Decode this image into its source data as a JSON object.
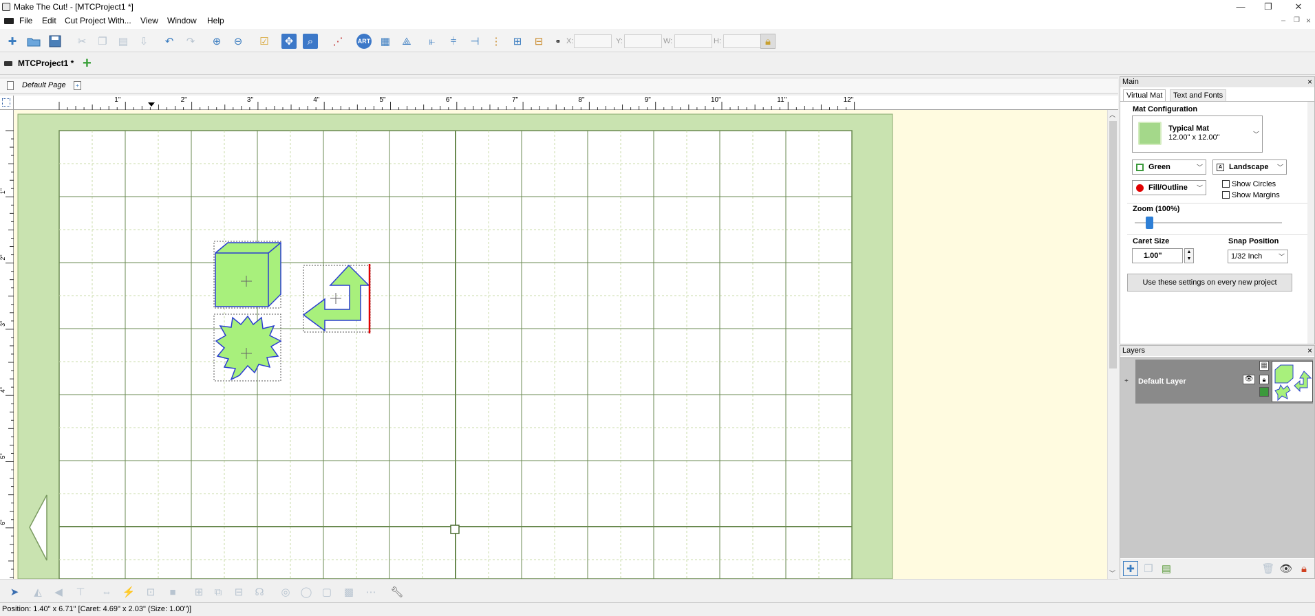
{
  "window": {
    "title": "Make The Cut! - [MTCProject1 *]",
    "minimize_glyph": "—",
    "maximize_glyph": "❐",
    "close_glyph": "✕"
  },
  "menu": {
    "items": [
      "File",
      "Edit",
      "Cut Project With...",
      "View",
      "Window",
      "Help"
    ]
  },
  "mdi": {
    "minimize_glyph": "–",
    "restore_glyph": "❐",
    "close_glyph": "×"
  },
  "toolbar": {
    "x_label": "X:",
    "y_label": "Y:",
    "w_label": "W:",
    "h_label": "H:",
    "x_value": "",
    "y_value": "",
    "w_value": "",
    "h_value": ""
  },
  "project_tab": {
    "label": "MTCProject1 *",
    "add_glyph": "+"
  },
  "page_tab": {
    "label": "Default Page"
  },
  "ruler": {
    "top_labels": [
      "1\"",
      "2\"",
      "3\"",
      "4\"",
      "5\"",
      "6\"",
      "7\"",
      "8\"",
      "9\"",
      "10\"",
      "11\"",
      "12\""
    ],
    "left_labels": [
      "1\"",
      "2\"",
      "3\"",
      "4\"",
      "5\"",
      "6\""
    ]
  },
  "status": {
    "text": "Position: 1.40\" x 6.71\" [Caret: 4.69\" x 2.03\" (Size: 1.00\")]"
  },
  "main_panel": {
    "title": "Main",
    "close_glyph": "×",
    "tabs": [
      "Virtual Mat",
      "Text and Fonts"
    ],
    "mat_config_title": "Mat Configuration",
    "mat_name": "Typical Mat",
    "mat_size": "12.00\" x 12.00\"",
    "color_select": "Green",
    "orientation_select": "Landscape",
    "fill_select": "Fill/Outline",
    "show_circles": "Show Circles",
    "show_margins": "Show Margins",
    "zoom_title": "Zoom (100%)",
    "zoom_level": 0.1,
    "caret_title": "Caret Size",
    "caret_value": "1.00\"",
    "snap_title": "Snap Position",
    "snap_value": "1/32 Inch",
    "use_settings_button": "Use these settings on every new project"
  },
  "layers_panel": {
    "title": "Layers",
    "close_glyph": "×",
    "layers": [
      {
        "name": "Default Layer",
        "expand_glyph": "+"
      }
    ]
  },
  "colors": {
    "mat_border": "#c9e3b0",
    "mat_grid_major": "#6a8a50",
    "mat_grid_minor": "#c8dba8",
    "shape_fill": "#a8f07c",
    "shape_stroke": "#2a3ed0",
    "caret_red": "#e00000",
    "outside_mat": "#fffbe0"
  }
}
